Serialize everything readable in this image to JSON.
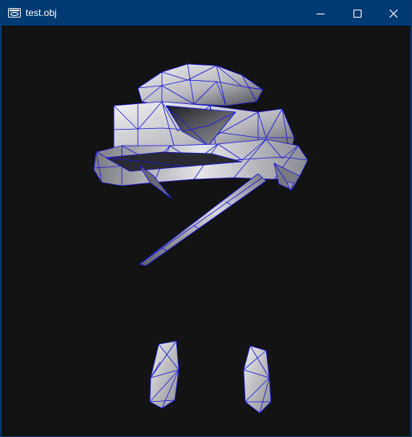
{
  "window": {
    "title": "test.obj",
    "icon": "app-window-icon",
    "controls": {
      "minimize_icon": "minimize-icon",
      "maximize_icon": "maximize-icon",
      "close_icon": "close-icon"
    }
  },
  "viewport": {
    "background_color": "#131313",
    "wireframe_color": "#1a1ad8",
    "surface_color": "#c8c8cc"
  },
  "colors": {
    "titlebar": "#003b73",
    "titlebar_text": "#ffffff"
  }
}
